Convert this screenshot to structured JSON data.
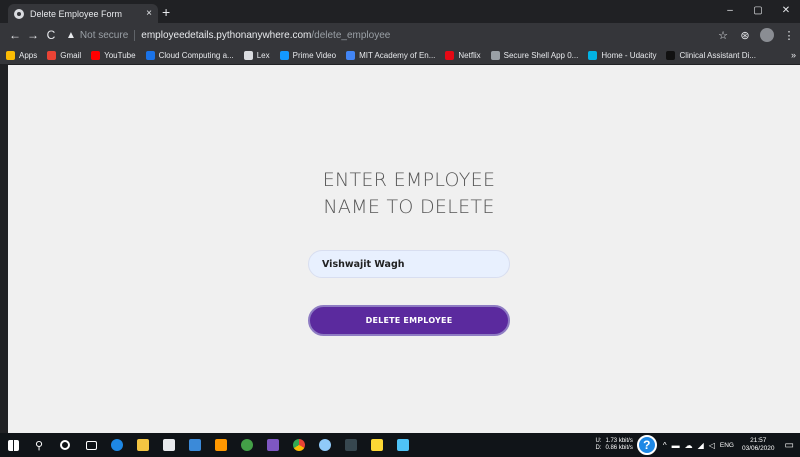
{
  "browser": {
    "tab_title": "Delete Employee Form",
    "tab_close": "×",
    "new_tab": "+",
    "window_controls": {
      "minimize": "–",
      "maximize": "▢",
      "close": "✕"
    },
    "nav": {
      "back": "←",
      "forward": "→",
      "reload": "C"
    },
    "url": {
      "security_label": "Not secure",
      "host": "employeedetails.pythonanywhere.com",
      "path": "/delete_employee"
    },
    "toolbar_icons": {
      "star": "☆",
      "extension": "⊛",
      "menu": "⋮"
    },
    "bookmarks": [
      {
        "label": "Apps",
        "color": "#fbbc04"
      },
      {
        "label": "Gmail",
        "color": "#ea4335"
      },
      {
        "label": "YouTube",
        "color": "#ff0000"
      },
      {
        "label": "Cloud Computing a...",
        "color": "#1a73e8"
      },
      {
        "label": "Lex",
        "color": "#dadce0"
      },
      {
        "label": "Prime Video",
        "color": "#1399ff"
      },
      {
        "label": "MIT Academy of En...",
        "color": "#4285f4"
      },
      {
        "label": "Netflix",
        "color": "#e50914"
      },
      {
        "label": "Secure Shell App 0...",
        "color": "#9aa0a6"
      },
      {
        "label": "Home - Udacity",
        "color": "#02b3e4"
      },
      {
        "label": "Clinical Assistant Di...",
        "color": "#111111"
      }
    ],
    "bookmarks_more": "»"
  },
  "page": {
    "heading_line1": "ENTER EMPLOYEE",
    "heading_line2": "NAME TO DELETE",
    "name_input_value": "Vishwajit Wagh",
    "delete_button_label": "DELETE EMPLOYEE"
  },
  "taskbar": {
    "network_up_label": "U:",
    "network_down_label": "D:",
    "network_up": "1.73 kbit/s",
    "network_down": "0.86 kbit/s",
    "help": "?",
    "tray_chevron": "^",
    "language": "ENG",
    "time": "21:57",
    "date": "03/06/2020",
    "notification": "▭"
  }
}
